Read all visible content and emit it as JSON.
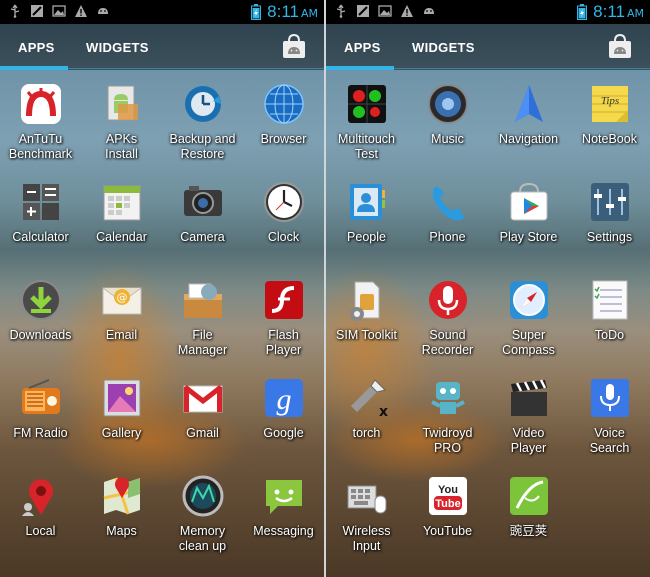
{
  "status_bar": {
    "time": "8:11",
    "ampm": "AM",
    "icons": [
      "usb-icon",
      "screenshot-icon",
      "image-icon",
      "warning-icon",
      "android-debug-icon",
      "battery-icon"
    ]
  },
  "tabs": {
    "apps": "APPS",
    "widgets": "WIDGETS"
  },
  "left_apps": [
    {
      "label": "AnTuTu\nBenchmark",
      "icon": "antutu-icon"
    },
    {
      "label": "APKs\nInstall",
      "icon": "apk-installer-icon"
    },
    {
      "label": "Backup and\nRestore",
      "icon": "backup-restore-icon"
    },
    {
      "label": "Browser",
      "icon": "globe-icon"
    },
    {
      "label": "Calculator",
      "icon": "calculator-icon"
    },
    {
      "label": "Calendar",
      "icon": "calendar-icon"
    },
    {
      "label": "Camera",
      "icon": "camera-icon"
    },
    {
      "label": "Clock",
      "icon": "clock-icon"
    },
    {
      "label": "Downloads",
      "icon": "download-icon"
    },
    {
      "label": "Email",
      "icon": "email-icon"
    },
    {
      "label": "File\nManager",
      "icon": "file-manager-icon"
    },
    {
      "label": "Flash\nPlayer",
      "icon": "flash-icon"
    },
    {
      "label": "FM Radio",
      "icon": "radio-icon"
    },
    {
      "label": "Gallery",
      "icon": "gallery-icon"
    },
    {
      "label": "Gmail",
      "icon": "gmail-icon"
    },
    {
      "label": "Google",
      "icon": "google-icon"
    },
    {
      "label": "Local",
      "icon": "location-pin-icon"
    },
    {
      "label": "Maps",
      "icon": "maps-icon"
    },
    {
      "label": "Memory\nclean up",
      "icon": "memory-clean-icon"
    },
    {
      "label": "Messaging",
      "icon": "messaging-icon"
    }
  ],
  "right_apps": [
    {
      "label": "Multitouch\nTest",
      "icon": "multitouch-icon"
    },
    {
      "label": "Music",
      "icon": "speaker-icon"
    },
    {
      "label": "Navigation",
      "icon": "navigation-arrow-icon"
    },
    {
      "label": "NoteBook",
      "icon": "notebook-icon"
    },
    {
      "label": "People",
      "icon": "contacts-icon"
    },
    {
      "label": "Phone",
      "icon": "phone-icon"
    },
    {
      "label": "Play Store",
      "icon": "play-store-icon"
    },
    {
      "label": "Settings",
      "icon": "settings-icon"
    },
    {
      "label": "SIM Toolkit",
      "icon": "sim-toolkit-icon"
    },
    {
      "label": "Sound\nRecorder",
      "icon": "microphone-icon"
    },
    {
      "label": "Super\nCompass",
      "icon": "compass-icon"
    },
    {
      "label": "ToDo",
      "icon": "todo-icon"
    },
    {
      "label": "torch",
      "icon": "torch-icon"
    },
    {
      "label": "Twidroyd\nPRO",
      "icon": "twidroyd-icon"
    },
    {
      "label": "Video\nPlayer",
      "icon": "clapperboard-icon"
    },
    {
      "label": "Voice\nSearch",
      "icon": "voice-search-icon"
    },
    {
      "label": "Wireless\nInput",
      "icon": "keyboard-mouse-icon"
    },
    {
      "label": "YouTube",
      "icon": "youtube-icon"
    },
    {
      "label": "豌豆荚",
      "icon": "wandoujia-icon"
    }
  ],
  "colors": {
    "accent": "#33b5e5",
    "status_bar": "#000000"
  }
}
